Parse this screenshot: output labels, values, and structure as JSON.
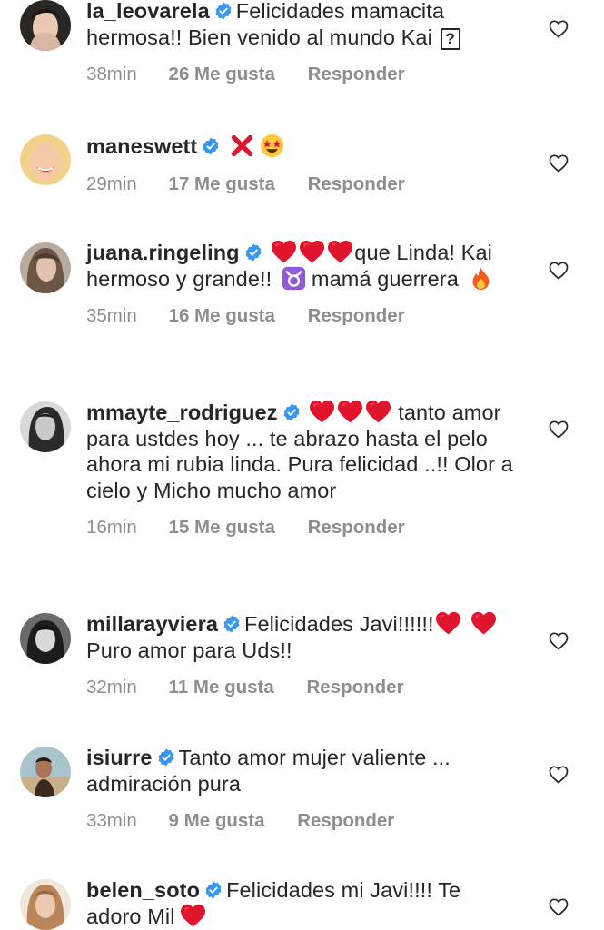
{
  "comments": [
    {
      "username": "la_leovarela",
      "text": "Felicidades mamacita hermosa!! Bien venido al mundo Kai",
      "box_glyph": "?",
      "time": "38min",
      "likes": "26 Me gusta",
      "reply": "Responder"
    },
    {
      "username": "maneswett",
      "text": "",
      "time": "29min",
      "likes": "17 Me gusta",
      "reply": "Responder"
    },
    {
      "username": "juana.ringeling",
      "text_a": "que Linda! Kai hermoso y grande!!",
      "text_b": "mamá guerrera",
      "time": "35min",
      "likes": "16 Me gusta",
      "reply": "Responder"
    },
    {
      "username": "mmayte_rodriguez",
      "text": "tanto amor para ustdes hoy ... te abrazo hasta el pelo ahora mi rubia linda. Pura felicidad ..!! Olor a cielo y Micho mucho amor",
      "time": "16min",
      "likes": "15 Me gusta",
      "reply": "Responder"
    },
    {
      "username": "millarayviera",
      "text_a": "Felicidades Javi!!!!!!",
      "text_b": "Puro amor para Uds!!",
      "time": "32min",
      "likes": "11 Me gusta",
      "reply": "Responder"
    },
    {
      "username": "isiurre",
      "text": "Tanto amor mujer valiente ... admiración pura",
      "time": "33min",
      "likes": "9 Me gusta",
      "reply": "Responder"
    },
    {
      "username": "belen_soto",
      "text": "Felicidades mi Javi!!!! Te adoro Mil",
      "time": "",
      "likes": "",
      "reply": ""
    }
  ],
  "icons": {
    "verified": "verified-badge-icon",
    "like": "heart-outline-icon"
  },
  "colors": {
    "verified": "#3897f0",
    "heart_emoji": "#e0142c",
    "meta_gray": "#8e8e8e",
    "text": "#262626"
  }
}
